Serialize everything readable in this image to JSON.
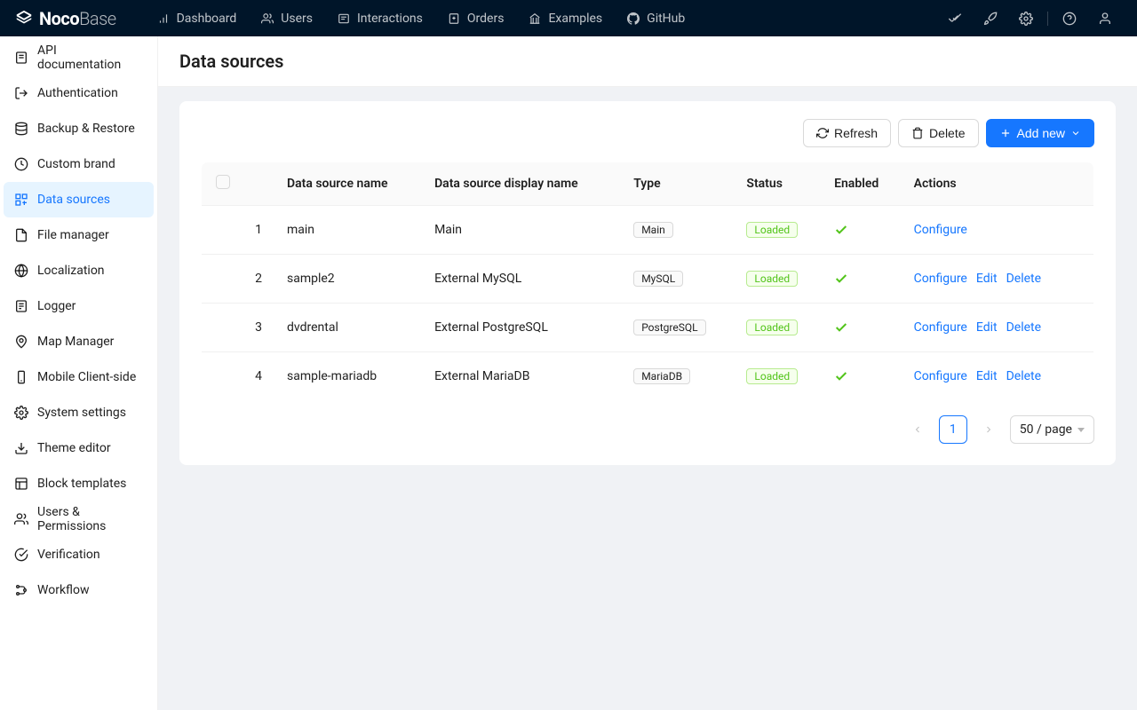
{
  "brand": {
    "name1": "Noco",
    "name2": "Base"
  },
  "nav": [
    {
      "label": "Dashboard",
      "icon": "bar-chart"
    },
    {
      "label": "Users",
      "icon": "users"
    },
    {
      "label": "Interactions",
      "icon": "message"
    },
    {
      "label": "Orders",
      "icon": "file"
    },
    {
      "label": "Examples",
      "icon": "bank"
    },
    {
      "label": "GitHub",
      "icon": "github"
    }
  ],
  "sidebar": {
    "items": [
      {
        "label": "API documentation"
      },
      {
        "label": "Authentication"
      },
      {
        "label": "Backup & Restore"
      },
      {
        "label": "Custom brand"
      },
      {
        "label": "Data sources",
        "active": true
      },
      {
        "label": "File manager"
      },
      {
        "label": "Localization"
      },
      {
        "label": "Logger"
      },
      {
        "label": "Map Manager"
      },
      {
        "label": "Mobile Client-side"
      },
      {
        "label": "System settings"
      },
      {
        "label": "Theme editor"
      },
      {
        "label": "Block templates"
      },
      {
        "label": "Users & Permissions"
      },
      {
        "label": "Verification"
      },
      {
        "label": "Workflow"
      }
    ]
  },
  "page": {
    "title": "Data sources"
  },
  "toolbar": {
    "refresh": "Refresh",
    "delete": "Delete",
    "add_new": "Add new"
  },
  "table": {
    "headers": {
      "name": "Data source name",
      "display_name": "Data source display name",
      "type": "Type",
      "status": "Status",
      "enabled": "Enabled",
      "actions": "Actions"
    },
    "rows": [
      {
        "idx": "1",
        "name": "main",
        "display": "Main",
        "type": "Main",
        "status": "Loaded",
        "enabled": true,
        "actions": [
          "Configure"
        ]
      },
      {
        "idx": "2",
        "name": "sample2",
        "display": "External MySQL",
        "type": "MySQL",
        "status": "Loaded",
        "enabled": true,
        "actions": [
          "Configure",
          "Edit",
          "Delete"
        ]
      },
      {
        "idx": "3",
        "name": "dvdrental",
        "display": "External PostgreSQL",
        "type": "PostgreSQL",
        "status": "Loaded",
        "enabled": true,
        "actions": [
          "Configure",
          "Edit",
          "Delete"
        ]
      },
      {
        "idx": "4",
        "name": "sample-mariadb",
        "display": "External MariaDB",
        "type": "MariaDB",
        "status": "Loaded",
        "enabled": true,
        "actions": [
          "Configure",
          "Edit",
          "Delete"
        ]
      }
    ]
  },
  "pagination": {
    "current": "1",
    "page_size": "50 / page"
  }
}
